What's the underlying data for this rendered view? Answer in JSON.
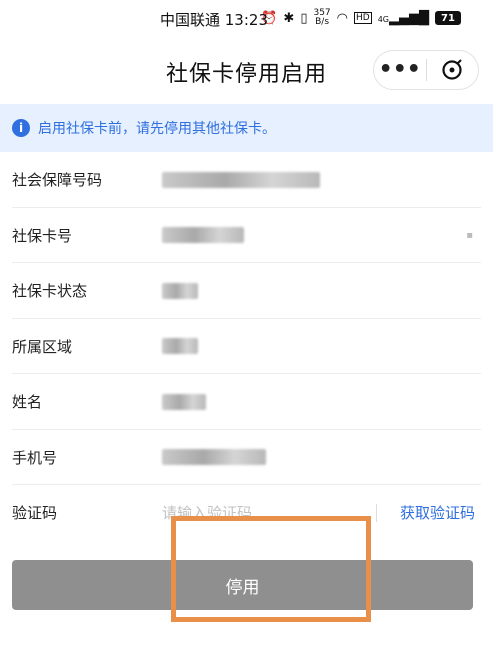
{
  "status_bar": {
    "carrier_time": "中国联通 13:23",
    "icons": [
      "alarm-icon",
      "bluetooth-icon",
      "vibrate-icon",
      "wifi-icon",
      "hd-icon",
      "signal-icon"
    ],
    "net_speed_value": "357",
    "net_speed_unit": "B/s",
    "signal_label": "4G",
    "hd_label": "HD",
    "battery": "71"
  },
  "header": {
    "title": "社保卡停用启用",
    "more_label": "•••"
  },
  "notice": {
    "text": "启用社保卡前，请先停用其他社保卡。",
    "icon_glyph": "i"
  },
  "form": {
    "rows": [
      {
        "label": "社会保障号码"
      },
      {
        "label": "社保卡号"
      },
      {
        "label": "社保卡状态"
      },
      {
        "label": "所属区域"
      },
      {
        "label": "姓名"
      },
      {
        "label": "手机号"
      }
    ],
    "verification": {
      "label": "验证码",
      "placeholder": "请输入验证码",
      "get_code_label": "获取验证码"
    }
  },
  "actions": {
    "disable_label": "停用"
  },
  "colors": {
    "accent": "#2f6fe0",
    "notice_bg": "#e6f0ff",
    "button_bg": "#8f8f8f",
    "highlight": "#e8904a"
  }
}
